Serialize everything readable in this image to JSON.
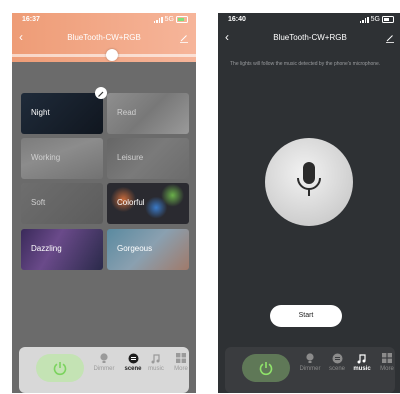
{
  "colors": {
    "accent_green": "#7bd35e",
    "header_peach": "#f2a583",
    "dark_bg": "#2e3134"
  },
  "screen1": {
    "status": {
      "time": "16:37",
      "network": "5G"
    },
    "header": {
      "title": "BlueTooth-CW+RGB",
      "back_icon": "chevron-left-icon",
      "edit_icon": "pencil-icon"
    },
    "brightness_slider_level": 0.55,
    "scenes": [
      {
        "label": "Night"
      },
      {
        "label": "Read"
      },
      {
        "label": "Working"
      },
      {
        "label": "Leisure"
      },
      {
        "label": "Soft"
      },
      {
        "label": "Colorful"
      },
      {
        "label": "Dazzling"
      },
      {
        "label": "Gorgeous"
      }
    ],
    "nav": [
      {
        "label": "Dimmer",
        "icon": "bulb-icon"
      },
      {
        "label": "scene",
        "icon": "scene-icon",
        "active": true
      },
      {
        "label": "music",
        "icon": "music-note-icon"
      },
      {
        "label": "More",
        "icon": "grid-icon"
      }
    ]
  },
  "screen2": {
    "status": {
      "time": "16:40",
      "network": "5G"
    },
    "header": {
      "title": "BlueTooth-CW+RGB",
      "back_icon": "chevron-left-icon",
      "edit_icon": "pencil-icon"
    },
    "note": "The lights will follow the music detected by the phone's microphone.",
    "start_label": "Start",
    "nav": [
      {
        "label": "Dimmer",
        "icon": "bulb-icon"
      },
      {
        "label": "scene",
        "icon": "scene-icon"
      },
      {
        "label": "music",
        "icon": "music-note-icon",
        "active": true
      },
      {
        "label": "More",
        "icon": "grid-icon"
      }
    ]
  }
}
